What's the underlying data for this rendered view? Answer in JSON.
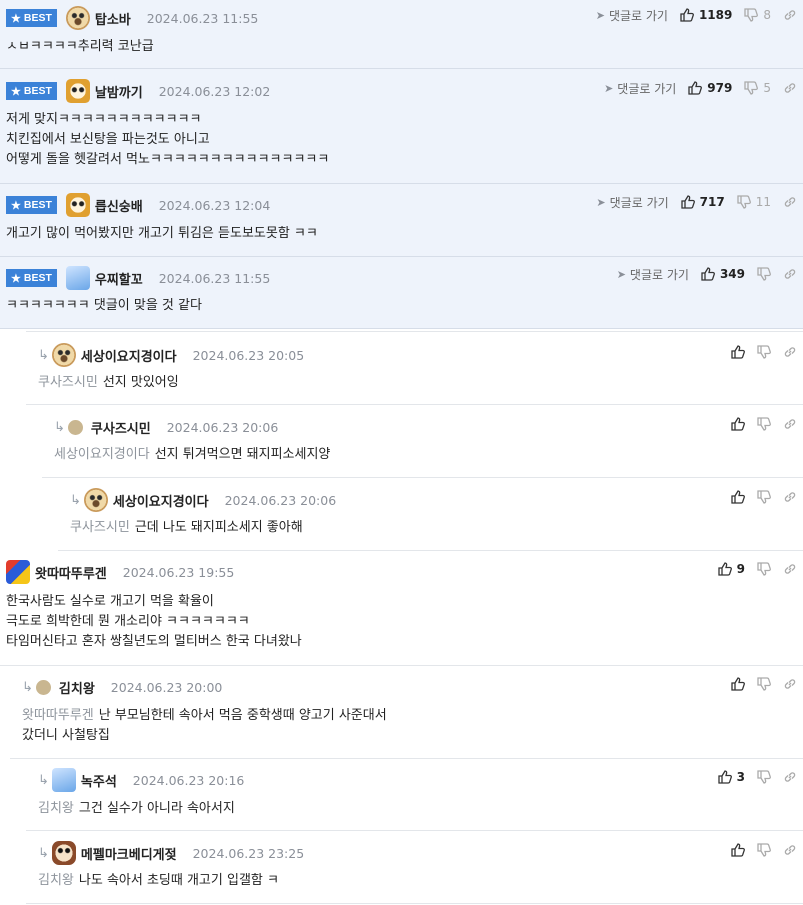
{
  "labels": {
    "best": "BEST",
    "goto": "댓글로 가기"
  },
  "comments": [
    {
      "nick": "탑소바",
      "date": "2024.06.23 11:55",
      "lines": [
        "ㅅㅂㅋㅋㅋㅋ추리력 코난급"
      ],
      "likes": "1189",
      "dislikes": "8"
    },
    {
      "nick": "날밤까기",
      "date": "2024.06.23 12:02",
      "lines": [
        "저게 맞지ㅋㅋㅋㅋㅋㅋㅋㅋㅋㅋㅋㅋ",
        "치킨집에서 보신탕을 파는것도 아니고",
        "어떻게 돌을 헷갈려서 먹노ㅋㅋㅋㅋㅋㅋㅋㅋㅋㅋㅋㅋㅋㅋㅋ"
      ],
      "likes": "979",
      "dislikes": "5"
    },
    {
      "nick": "릅신숭배",
      "date": "2024.06.23 12:04",
      "lines": [
        "개고기 많이 먹어봤지만 개고기 튀김은 듣도보도못함 ㅋㅋ"
      ],
      "likes": "717",
      "dislikes": "11"
    },
    {
      "nick": "우찌할꼬",
      "date": "2024.06.23 11:55",
      "lines": [
        "ㅋㅋㅋㅋㅋㅋㅋ 댓글이 맞을 것 같다"
      ],
      "likes": "349",
      "dislikes": ""
    },
    {
      "nick": "세상이요지경이다",
      "date": "2024.06.23 20:05",
      "mention": "쿠사즈시민",
      "lines": [
        "선지 맛있어잉"
      ],
      "likes": "",
      "dislikes": ""
    },
    {
      "nick": "쿠사즈시민",
      "date": "2024.06.23 20:06",
      "mention": "세상이요지경이다",
      "lines": [
        "선지 튀겨먹으면 돼지피소세지양"
      ],
      "likes": "",
      "dislikes": ""
    },
    {
      "nick": "세상이요지경이다",
      "date": "2024.06.23 20:06",
      "mention": "쿠사즈시민",
      "lines": [
        "근데 나도 돼지피소세지 좋아해"
      ],
      "likes": "",
      "dislikes": ""
    },
    {
      "nick": "왓따따뚜루겐",
      "date": "2024.06.23 19:55",
      "lines": [
        "한국사람도 실수로 개고기 먹을 확율이",
        "극도로 희박한데 뭔 개소리야 ㅋㅋㅋㅋㅋㅋㅋ",
        "타임머신타고 혼자 쌍칠년도의 멀티버스 한국 다녀왔나"
      ],
      "likes": "9",
      "dislikes": ""
    },
    {
      "nick": "김치왕",
      "date": "2024.06.23 20:00",
      "mention": "왓따따뚜루겐",
      "lines": [
        "난 부모님한테 속아서 먹음 중학생때 양고기 사준대서",
        "갔더니 사철탕집"
      ],
      "likes": "",
      "dislikes": ""
    },
    {
      "nick": "녹주석",
      "date": "2024.06.23 20:16",
      "mention": "김치왕",
      "lines": [
        "그건 실수가 아니라 속아서지"
      ],
      "likes": "3",
      "dislikes": ""
    },
    {
      "nick": "메펠마크베디게젖",
      "date": "2024.06.23 23:25",
      "mention": "김치왕",
      "lines": [
        "나도 속아서 초딩때 개고기 입갤함 ㅋ"
      ],
      "likes": "",
      "dislikes": ""
    }
  ],
  "icons": {
    "like": "thumbs-up-icon",
    "dislike": "thumbs-down-icon",
    "link": "link-icon",
    "goto": "send-arrow-icon",
    "reply": "reply-arrow-icon"
  },
  "colors": {
    "best_bg": "#eef3fb",
    "badge": "#3b82d8",
    "mention": "#8e949c"
  }
}
